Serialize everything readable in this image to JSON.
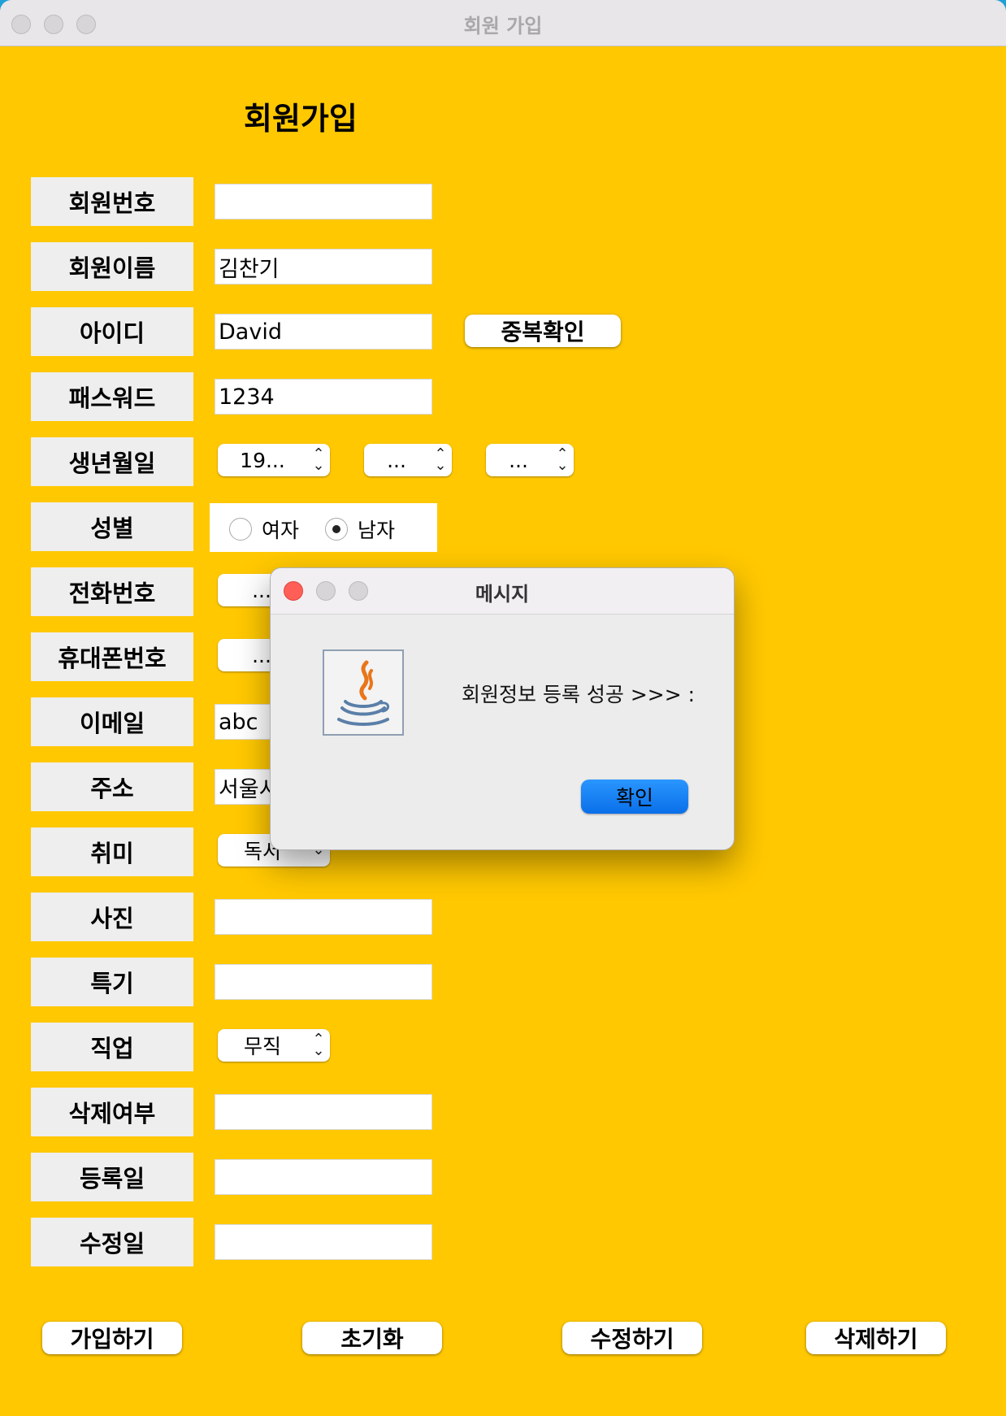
{
  "window": {
    "title": "회원 가입"
  },
  "form": {
    "heading": "회원가입",
    "labels": {
      "member_no": "회원번호",
      "member_name": "회원이름",
      "user_id": "아이디",
      "password": "패스워드",
      "birth": "생년월일",
      "gender": "성별",
      "phone": "전화번호",
      "mobile": "휴대폰번호",
      "email": "이메일",
      "address": "주소",
      "hobby": "취미",
      "photo": "사진",
      "specialty": "특기",
      "job": "직업",
      "deleted": "삭제여부",
      "reg_date": "등록일",
      "mod_date": "수정일"
    },
    "values": {
      "member_no": "",
      "member_name": "김찬기",
      "user_id": "David",
      "password": "1234",
      "email": "abc",
      "address": "서울시",
      "photo": "",
      "specialty": "",
      "deleted": "",
      "reg_date": "",
      "mod_date": ""
    },
    "birth": {
      "year": "19...",
      "month": "...",
      "day": "..."
    },
    "phone": {
      "prefix": "..."
    },
    "mobile": {
      "prefix": "..."
    },
    "hobby": {
      "selected": "독서"
    },
    "job": {
      "selected": "무직"
    },
    "gender": {
      "female": "여자",
      "male": "남자",
      "selected": "male"
    },
    "dup_check_button": "중복확인",
    "buttons": {
      "join": "가입하기",
      "reset": "초기화",
      "modify": "수정하기",
      "delete": "삭제하기"
    }
  },
  "dialog": {
    "title": "메시지",
    "message": "회원정보 등록 성공 >>> :",
    "ok": "확인"
  },
  "colors": {
    "background": "#ffc800",
    "label_bg": "#eeeeee",
    "ok_button": "#0a6fe8",
    "close_red": "#ff5f57"
  },
  "icons": {
    "dialog_icon": "java-coffee-cup-icon",
    "spinner": "up-down-chevron-icon",
    "dropdown": "chevron-down-icon"
  }
}
